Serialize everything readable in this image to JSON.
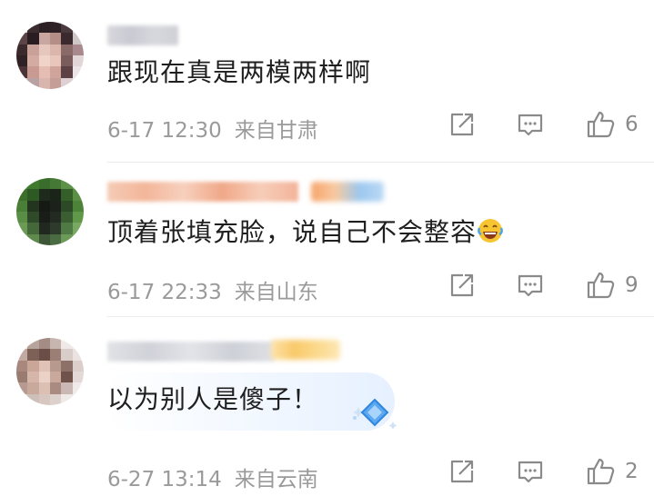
{
  "comments": [
    {
      "text": "跟现在真是两模两样啊",
      "time": "6-17 12:30",
      "location": "来自甘肃",
      "likes": "6"
    },
    {
      "text": "顶着张填充脸，说自己不会整容",
      "time": "6-17 22:33",
      "location": "来自山东",
      "likes": "9"
    },
    {
      "text": "以为别人是傻子！",
      "time": "6-27 13:14",
      "location": "来自云南",
      "likes": "2"
    }
  ],
  "icons": {
    "share": "share-icon",
    "comment": "comment-icon",
    "like": "thumbs-up-icon",
    "emoji": "laughing-tears-emoji",
    "decoration": "blue-diamond-decoration"
  },
  "colors": {
    "meta": "#9a9a9a",
    "text": "#1f1f1f",
    "icon": "#8a8a8a"
  }
}
